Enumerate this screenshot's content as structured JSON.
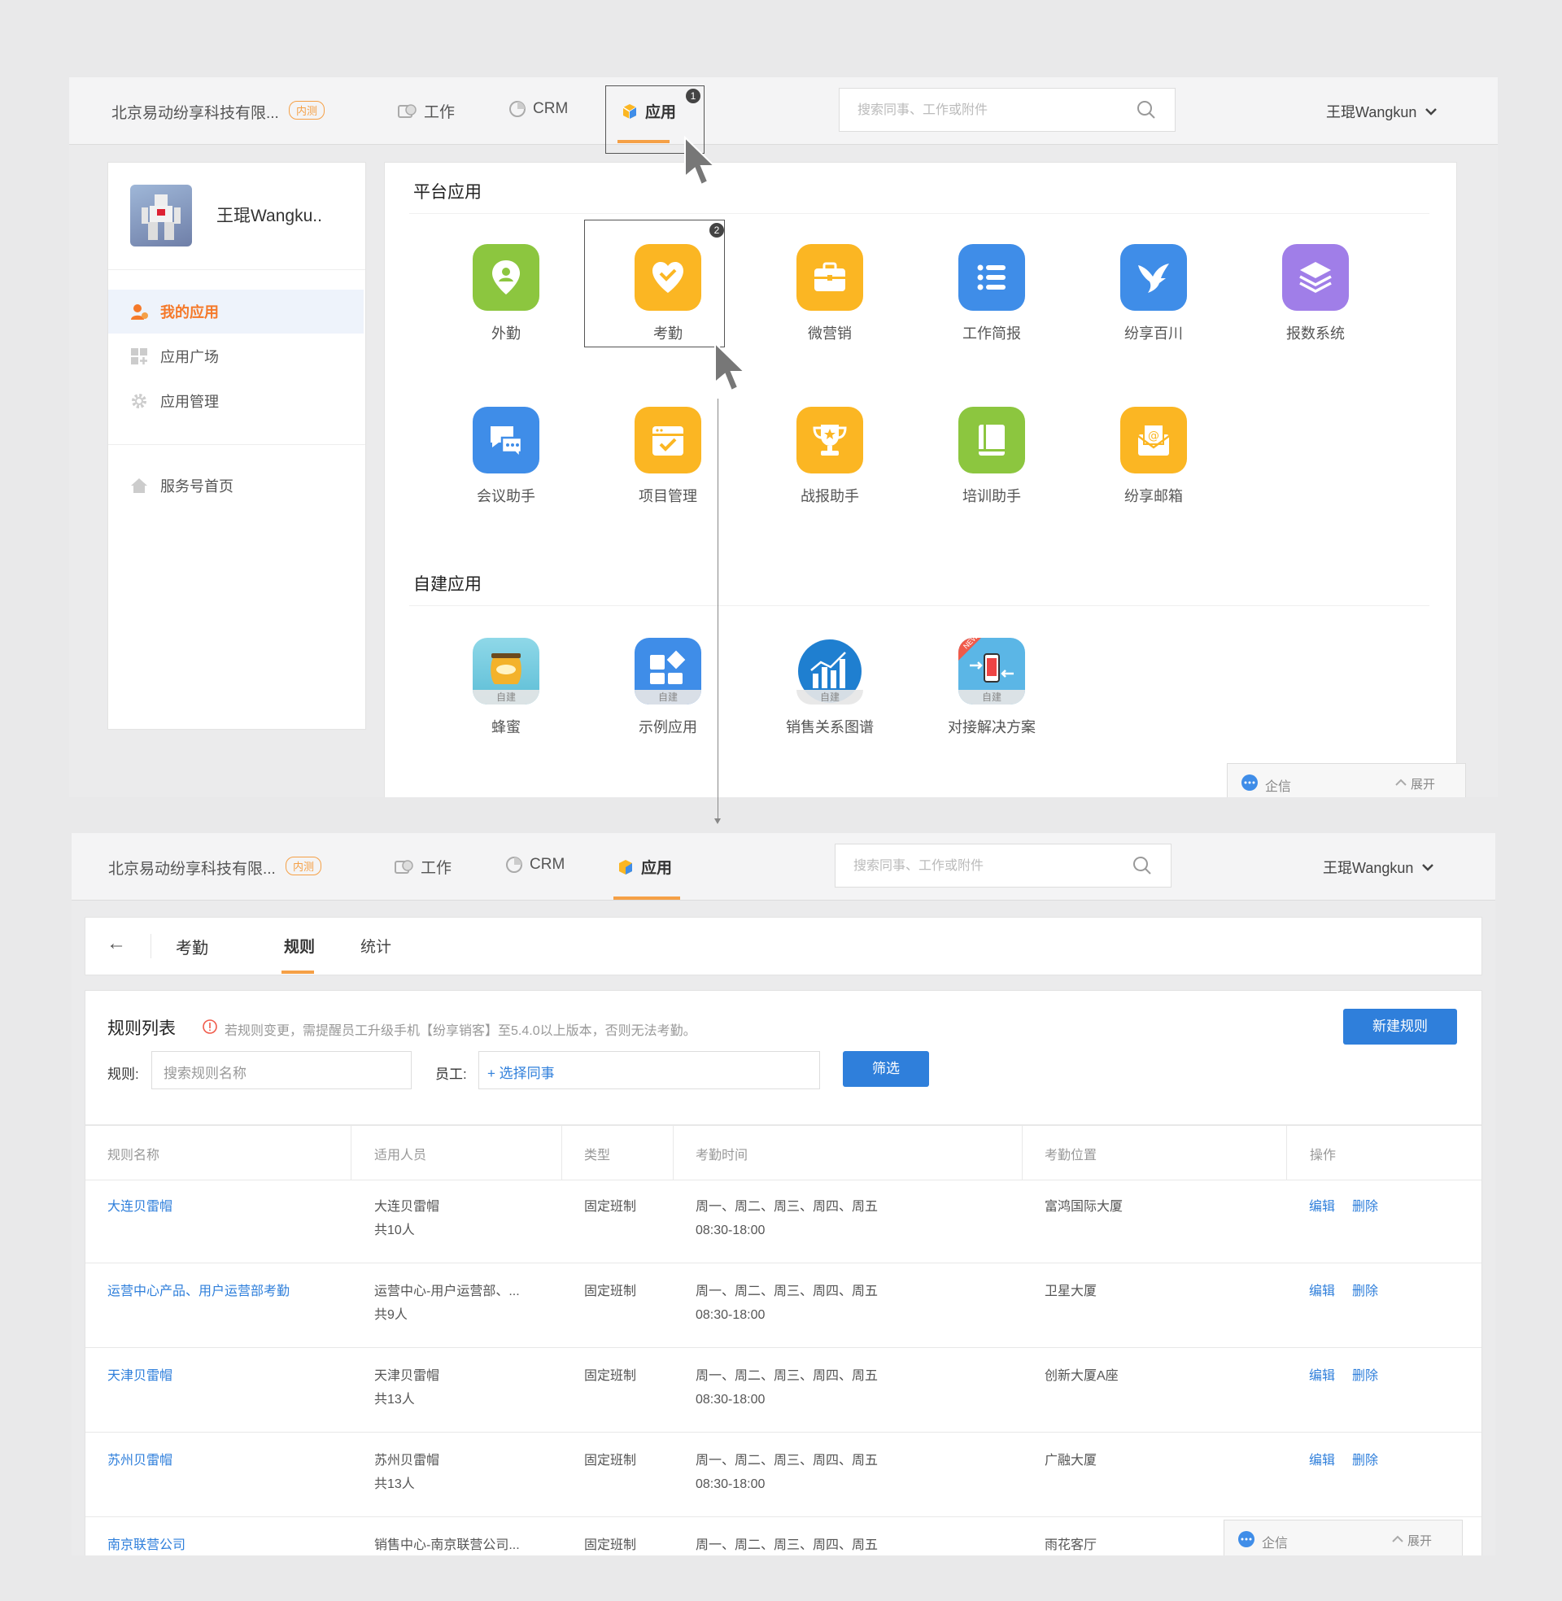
{
  "nav": {
    "company": "北京易动纷享科技有限...",
    "company_badge": "内测",
    "tabs": [
      {
        "label": "工作",
        "icon": "work-icon"
      },
      {
        "label": "CRM",
        "icon": "crm-icon"
      },
      {
        "label": "应用",
        "icon": "app-cube-icon"
      }
    ],
    "search_placeholder": "搜索同事、工作或附件",
    "user": "王琨Wangkun",
    "step1": "1"
  },
  "sidebar": {
    "user_name": "王琨Wangku..",
    "items": [
      {
        "label": "我的应用",
        "icon": "my-apps-icon"
      },
      {
        "label": "应用广场",
        "icon": "app-square-icon"
      },
      {
        "label": "应用管理",
        "icon": "gear-icon"
      },
      {
        "label": "服务号首页",
        "icon": "home-icon"
      }
    ]
  },
  "platform": {
    "title": "平台应用",
    "apps": [
      {
        "label": "外勤",
        "icon": "location-pin-icon",
        "color": "#8cc63f"
      },
      {
        "label": "考勤",
        "icon": "checkin-heart-icon",
        "color": "#fbb623"
      },
      {
        "label": "微营销",
        "icon": "briefcase-icon",
        "color": "#fbb623"
      },
      {
        "label": "工作简报",
        "icon": "list-icon",
        "color": "#3f8de8"
      },
      {
        "label": "纷享百川",
        "icon": "bird-icon",
        "color": "#3f8de8"
      },
      {
        "label": "报数系统",
        "icon": "layers-icon",
        "color": "#a07ee8"
      },
      {
        "label": "会议助手",
        "icon": "chat-bubbles-icon",
        "color": "#3f8de8"
      },
      {
        "label": "项目管理",
        "icon": "calendar-check-icon",
        "color": "#fbb623"
      },
      {
        "label": "战报助手",
        "icon": "trophy-icon",
        "color": "#fbb623"
      },
      {
        "label": "培训助手",
        "icon": "book-icon",
        "color": "#8cc63f"
      },
      {
        "label": "纷享邮箱",
        "icon": "mail-icon",
        "color": "#fbb623"
      }
    ],
    "step2": "2"
  },
  "custom": {
    "title": "自建应用",
    "tag": "自建",
    "new_tag": "NEW",
    "apps": [
      {
        "label": "蜂蜜",
        "icon": "honey-jar-icon"
      },
      {
        "label": "示例应用",
        "icon": "blocks-icon"
      },
      {
        "label": "销售关系图谱",
        "icon": "bar-chart-icon"
      },
      {
        "label": "对接解决方案",
        "icon": "phone-transfer-icon"
      }
    ]
  },
  "qixin": {
    "label": "企信",
    "expand": "展开"
  },
  "attendance": {
    "back": "←",
    "title": "考勤",
    "tabs": [
      "规则",
      "统计"
    ],
    "list_title": "规则列表",
    "notice": "若规则变更，需提醒员工升级手机【纷享销客】至5.4.0以上版本，否则无法考勤。",
    "new_button": "新建规则",
    "filter": {
      "rule_label": "规则:",
      "rule_placeholder": "搜索规则名称",
      "staff_label": "员工:",
      "staff_picker": "+ 选择同事",
      "button": "筛选"
    },
    "columns": [
      "规则名称",
      "适用人员",
      "类型",
      "考勤时间",
      "考勤位置",
      "操作"
    ],
    "actions": {
      "edit": "编辑",
      "delete": "删除"
    },
    "rows": [
      {
        "name": "大连贝雷帽",
        "staff": "大连贝雷帽",
        "count": "共10人",
        "type": "固定班制",
        "days": "周一、周二、周三、周四、周五",
        "time": "08:30-18:00",
        "location": "富鸿国际大厦"
      },
      {
        "name": "运营中心产品、用户运营部考勤",
        "staff": "运营中心-用户运营部、...",
        "count": "共9人",
        "type": "固定班制",
        "days": "周一、周二、周三、周四、周五",
        "time": "08:30-18:00",
        "location": "卫星大厦"
      },
      {
        "name": "天津贝雷帽",
        "staff": "天津贝雷帽",
        "count": "共13人",
        "type": "固定班制",
        "days": "周一、周二、周三、周四、周五",
        "time": "08:30-18:00",
        "location": "创新大厦A座"
      },
      {
        "name": "苏州贝雷帽",
        "staff": "苏州贝雷帽",
        "count": "共13人",
        "type": "固定班制",
        "days": "周一、周二、周三、周四、周五",
        "time": "08:30-18:00",
        "location": "广融大厦"
      },
      {
        "name": "南京联营公司",
        "staff": "销售中心-南京联营公司...",
        "type": "固定班制",
        "days": "周一、周二、周三、周四、周五",
        "location": "雨花客厅"
      }
    ]
  }
}
